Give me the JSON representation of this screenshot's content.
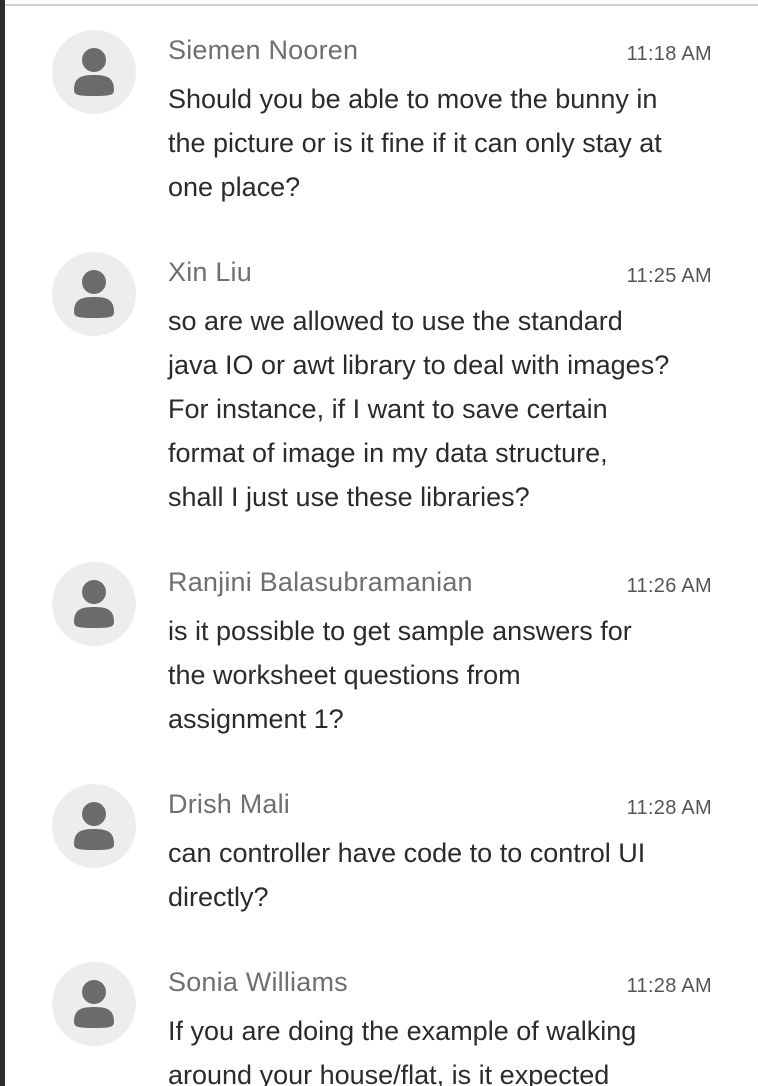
{
  "messages": [
    {
      "author": "Siemen Nooren",
      "time": "11:18 AM",
      "text": "Should you be able to move the bunny in\nthe picture or is it fine if it can only stay at\none place?",
      "avatar_icon": "user-placeholder-icon"
    },
    {
      "author": "Xin Liu",
      "time": "11:25 AM",
      "text": "so are we allowed to use the standard\njava IO or awt library to deal with images?\nFor instance, if I want to save certain\nformat of image in my data structure,\nshall I just use these libraries?",
      "avatar_icon": "user-placeholder-icon"
    },
    {
      "author": "Ranjini Balasubramanian",
      "time": "11:26 AM",
      "text": "is it possible to get sample answers for\nthe worksheet questions from\nassignment 1?",
      "avatar_icon": "user-placeholder-icon"
    },
    {
      "author": "Drish Mali",
      "time": "11:28 AM",
      "text": "can controller have code to to control UI\ndirectly?",
      "avatar_icon": "user-placeholder-icon"
    },
    {
      "author": "Sonia Williams",
      "time": "11:28 AM",
      "text": "If you are doing the example of walking\naround your house/flat, is it expected",
      "avatar_icon": "user-placeholder-icon"
    }
  ],
  "colors": {
    "author": "#6f6f6f",
    "time": "#555555",
    "text": "#2b2b2b",
    "avatar_bg": "#ededed",
    "avatar_figure": "#6b6b6b"
  }
}
